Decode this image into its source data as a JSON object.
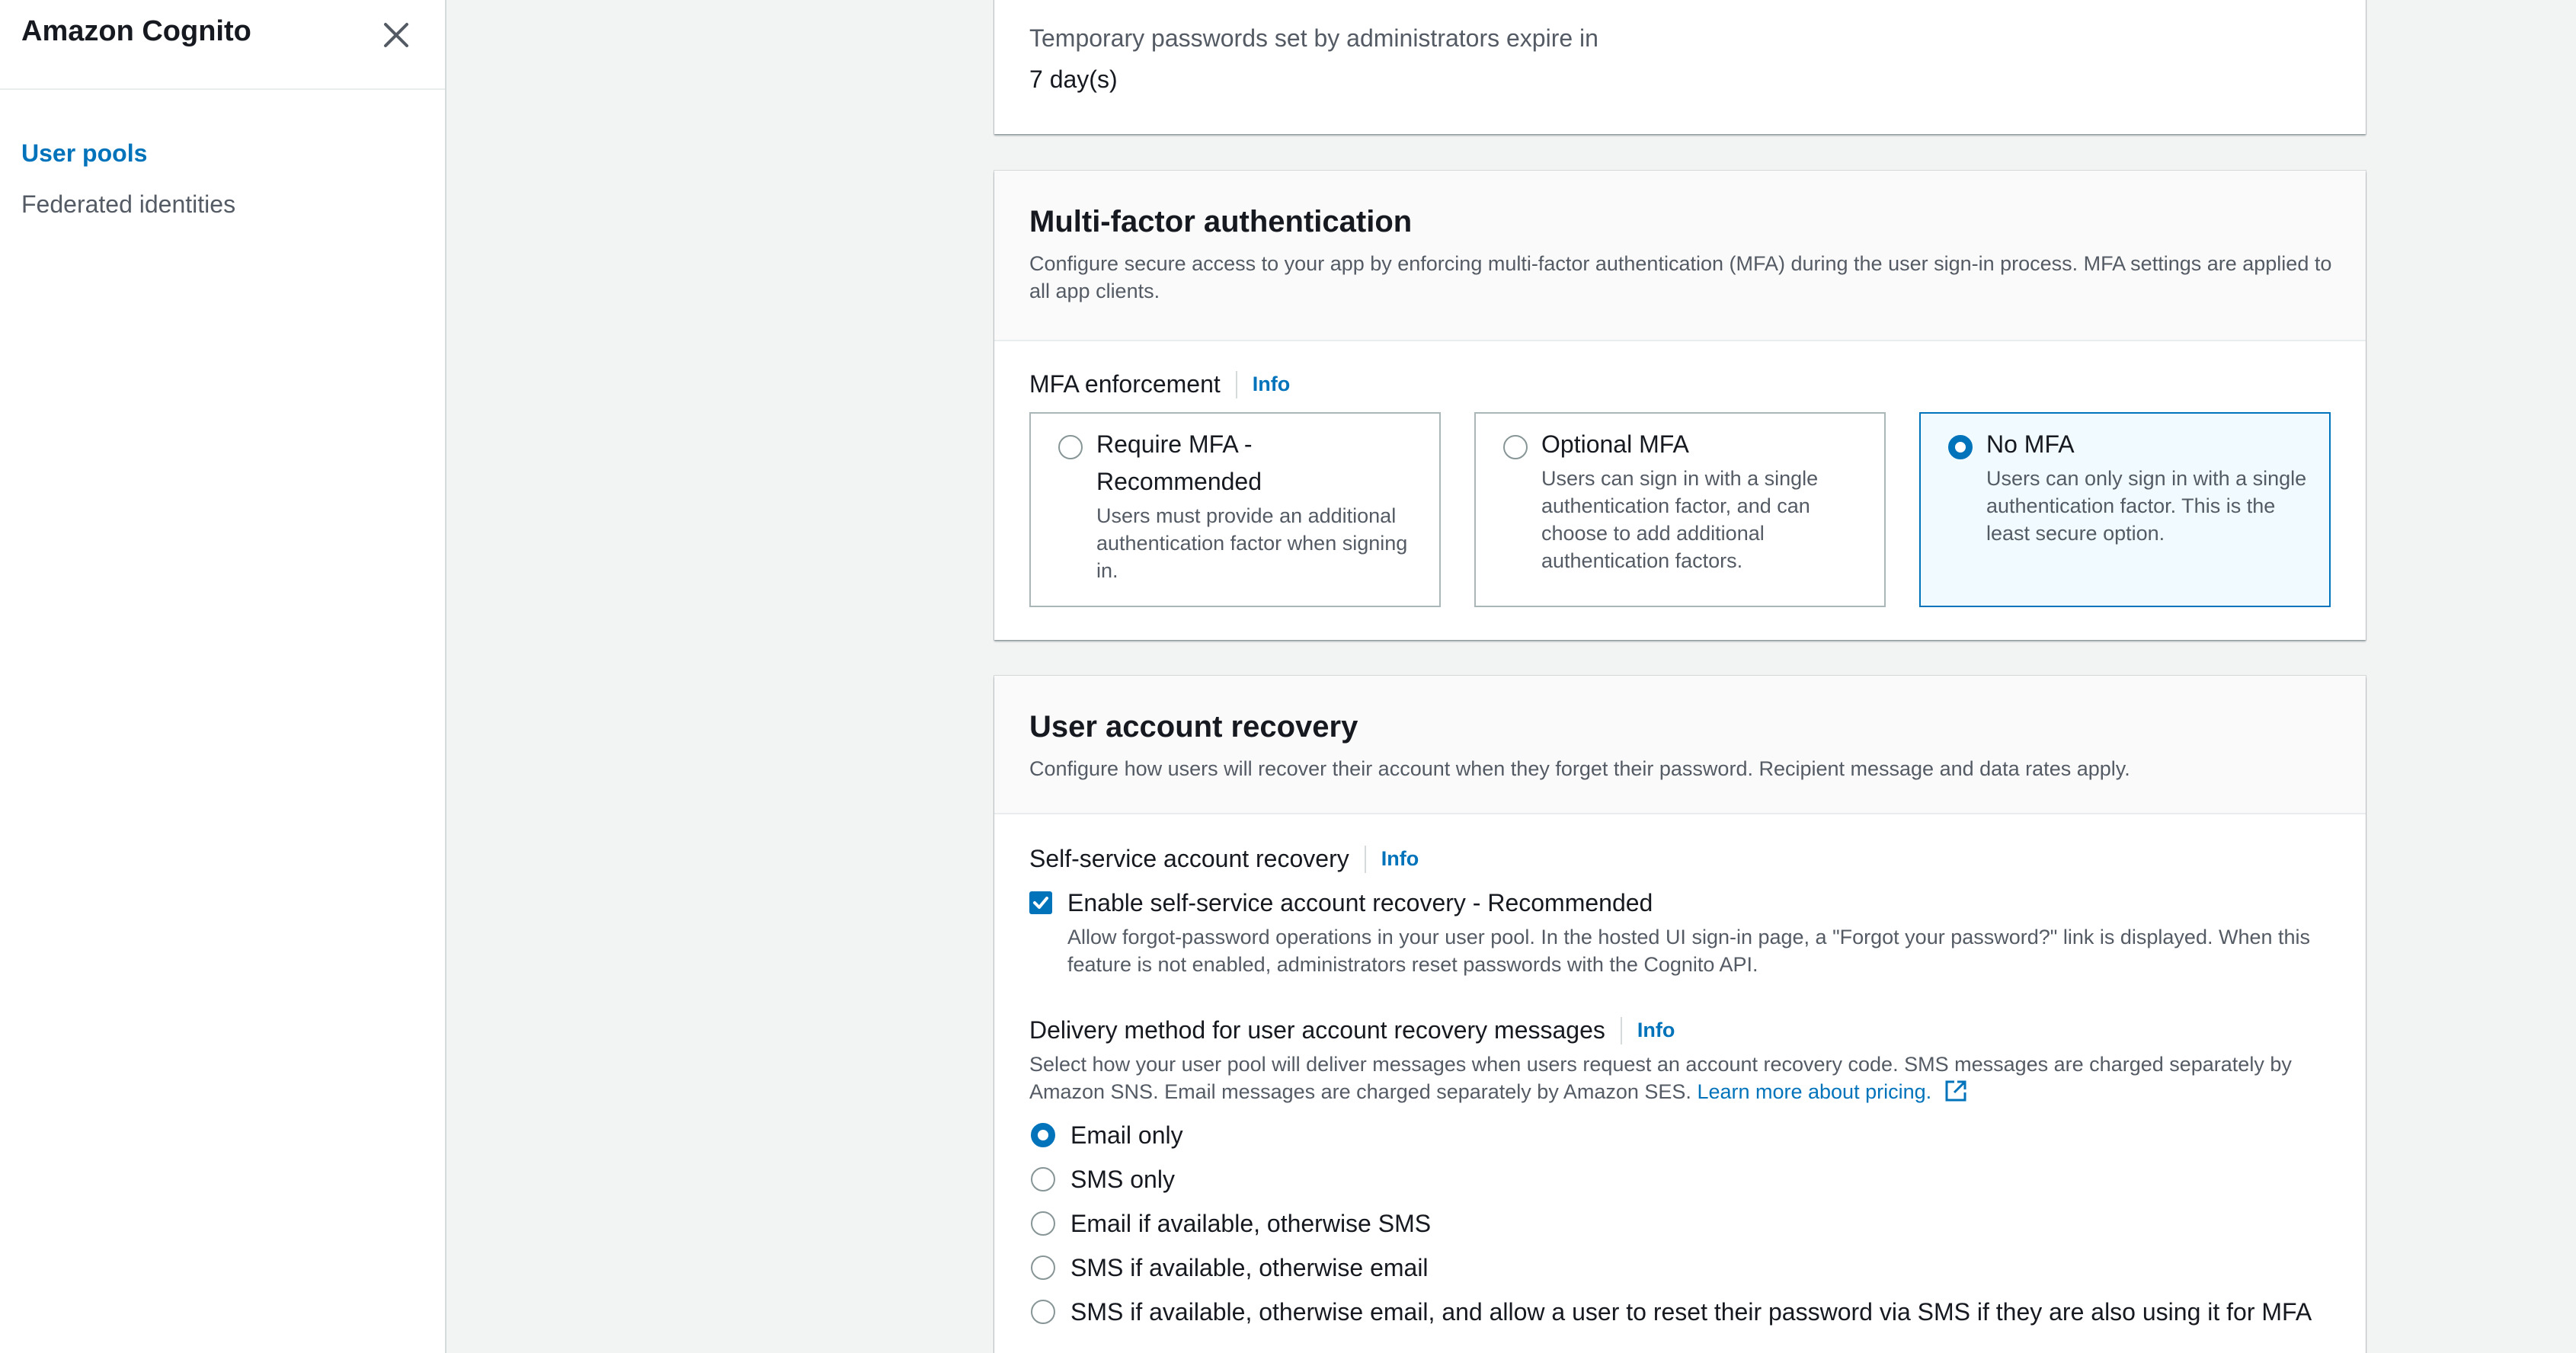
{
  "sidebar": {
    "title": "Amazon Cognito",
    "items": [
      {
        "label": "User pools",
        "active": true
      },
      {
        "label": "Federated identities",
        "active": false
      }
    ]
  },
  "temp_password": {
    "label": "Temporary passwords set by administrators expire in",
    "value": "7 day(s)"
  },
  "mfa": {
    "title": "Multi-factor authentication",
    "description": "Configure secure access to your app by enforcing multi-factor authentication (MFA) during the user sign-in process. MFA settings are applied to all app clients.",
    "enforcement_label": "MFA enforcement",
    "info": "Info",
    "options": [
      {
        "title": "Require MFA - Recommended",
        "description": "Users must provide an additional authentication factor when signing in.",
        "selected": false
      },
      {
        "title": "Optional MFA",
        "description": "Users can sign in with a single authentication factor, and can choose to add additional authentication factors.",
        "selected": false
      },
      {
        "title": "No MFA",
        "description": "Users can only sign in with a single authentication factor. This is the least secure option.",
        "selected": true
      }
    ]
  },
  "recovery": {
    "title": "User account recovery",
    "description": "Configure how users will recover their account when they forget their password. Recipient message and data rates apply.",
    "self_service_label": "Self-service account recovery",
    "info": "Info",
    "checkbox_label": "Enable self-service account recovery - Recommended",
    "checkbox_desc": "Allow forgot-password operations in your user pool. In the hosted UI sign-in page, a \"Forgot your password?\" link is displayed. When this feature is not enabled, administrators reset passwords with the Cognito API.",
    "checkbox_checked": true,
    "delivery_label": "Delivery method for user account recovery messages",
    "delivery_desc": "Select how your user pool will deliver messages when users request an account recovery code. SMS messages are charged separately by Amazon SNS. Email messages are charged separately by Amazon SES.",
    "learn_more": "Learn more about pricing.",
    "delivery_options": [
      {
        "label": "Email only",
        "selected": true
      },
      {
        "label": "SMS only",
        "selected": false
      },
      {
        "label": "Email if available, otherwise SMS",
        "selected": false
      },
      {
        "label": "SMS if available, otherwise email",
        "selected": false
      },
      {
        "label": "SMS if available, otherwise email, and allow a user to reset their password via SMS if they are also using it for MFA",
        "selected": false
      }
    ]
  },
  "colors": {
    "accent": "#0073bb",
    "page_background": "#f2f3f3",
    "selected_tile_background": "#f1faff"
  },
  "icons": {
    "close": "close-icon",
    "external_link": "external-link-icon",
    "checkmark": "checkmark-icon"
  }
}
